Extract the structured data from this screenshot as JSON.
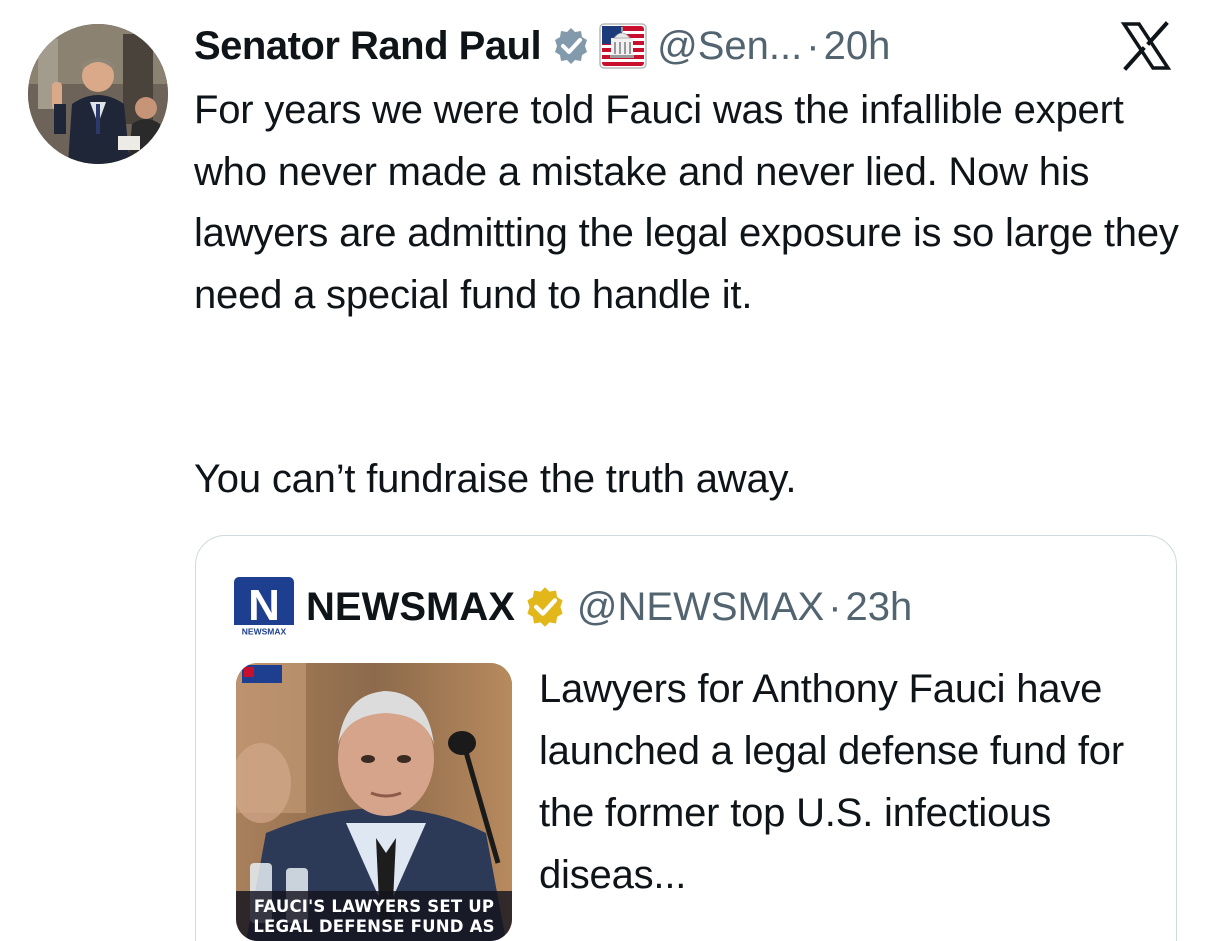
{
  "tweet": {
    "display_name": "Senator Rand Paul",
    "handle": "@Sen...",
    "separator": "·",
    "time": "20h",
    "verified_icon": "verified-badge-icon",
    "affiliation_icon": "us-capitol-flag-icon",
    "platform_icon": "x-logo-icon",
    "body": {
      "paragraph_1": "For years we were told Fauci was the infallible expert who never made a mistake and never lied. Now his lawyers are admitting the legal exposure is so large they need a special fund to handle it.",
      "paragraph_2": "You can’t fundraise the truth away."
    }
  },
  "quoted_tweet": {
    "display_name": "NEWSMAX",
    "handle": "@NEWSMAX",
    "separator": "·",
    "time": "23h",
    "avatar_label": "N",
    "avatar_sublabel": "NEWSMAX",
    "verified_icon": "gold-verified-badge-icon",
    "text": "Lawyers for Anthony Fauci have launched a legal defense fund for the former top U.S. infectious diseas...",
    "media": {
      "caption_line_1": "FAUCI'S LAWYERS SET UP",
      "caption_line_2": "LEGAL DEFENSE FUND AS"
    }
  },
  "colors": {
    "text_primary": "#0f1419",
    "text_secondary": "#536471",
    "verified_blue": "#829aab",
    "verified_gold": "#e2b719",
    "newsmax_blue": "#1e3f8f",
    "border": "#cfd9de"
  }
}
